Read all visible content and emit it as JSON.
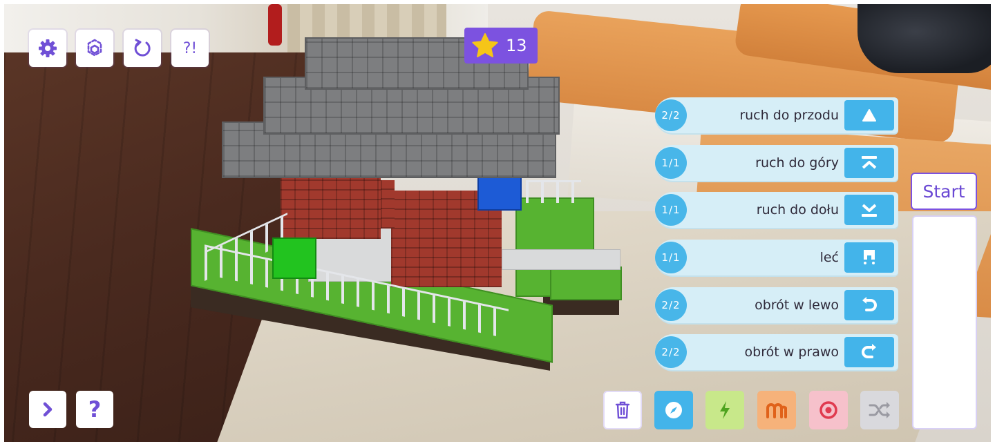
{
  "top_toolbar": {
    "help_label": "?!"
  },
  "stars": {
    "count": "13",
    "icon": "star-icon",
    "color": "#f5c518"
  },
  "commands": [
    {
      "count": "2/2",
      "label": "ruch do przodu",
      "icon": "arrow-up-icon"
    },
    {
      "count": "1/1",
      "label": "ruch do góry",
      "icon": "jump-up-icon"
    },
    {
      "count": "1/1",
      "label": "ruch do dołu",
      "icon": "jump-down-icon"
    },
    {
      "count": "1/1",
      "label": "leć",
      "icon": "fly-icon"
    },
    {
      "count": "2/2",
      "label": "obrót w lewo",
      "icon": "rotate-left-icon"
    },
    {
      "count": "2/2",
      "label": "obrót w prawo",
      "icon": "rotate-right-icon"
    }
  ],
  "program": {
    "start_label": "Start"
  },
  "categories": [
    {
      "name": "trash-icon",
      "color": "#ffffff"
    },
    {
      "name": "compass-icon",
      "color": "#43b4ea"
    },
    {
      "name": "lightning-icon",
      "color": "#c8e88a"
    },
    {
      "name": "magnet-icon",
      "color": "#f6a96a"
    },
    {
      "name": "target-icon",
      "color": "#f3b3c0"
    },
    {
      "name": "shuffle-icon",
      "color": "#d4d4d8"
    }
  ],
  "bottom_nav": {
    "help_label": "?"
  },
  "colors": {
    "accent": "#7c52e0",
    "command_bg": "#d6eef7",
    "command_icon_bg": "#43b4ea"
  }
}
